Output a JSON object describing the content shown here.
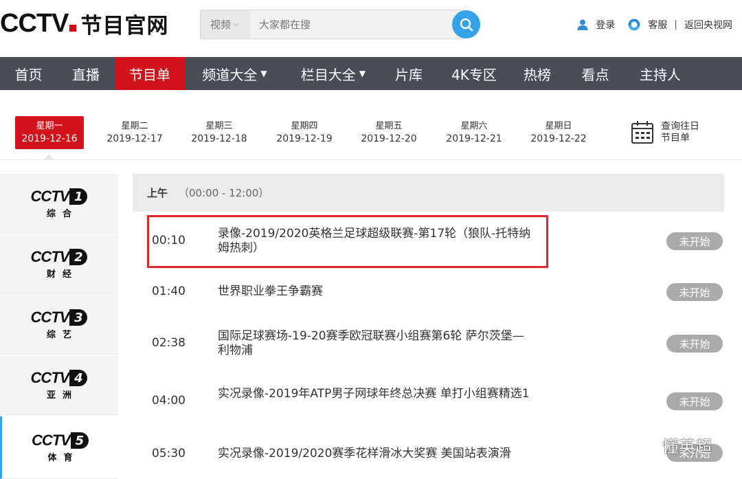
{
  "header": {
    "logo_text": "CCTV",
    "site_name": "节目官网",
    "search": {
      "category": "视频",
      "placeholder": "大家都在搜"
    },
    "login": "登录",
    "service": "客服",
    "separator": "|",
    "return_link": "返回央视网"
  },
  "nav": {
    "items": [
      {
        "label": "首页"
      },
      {
        "label": "直播"
      },
      {
        "label": "节目单"
      },
      {
        "label": "频道大全"
      },
      {
        "label": "栏目大全"
      },
      {
        "label": "片库"
      },
      {
        "label": "4K专区"
      },
      {
        "label": "热榜"
      },
      {
        "label": "看点"
      },
      {
        "label": "主持人"
      }
    ]
  },
  "dates": [
    {
      "weekday": "星期一",
      "date": "2019-12-16"
    },
    {
      "weekday": "星期二",
      "date": "2019-12-17"
    },
    {
      "weekday": "星期三",
      "date": "2019-12-18"
    },
    {
      "weekday": "星期四",
      "date": "2019-12-19"
    },
    {
      "weekday": "星期五",
      "date": "2019-12-20"
    },
    {
      "weekday": "星期六",
      "date": "2019-12-21"
    },
    {
      "weekday": "星期日",
      "date": "2019-12-22"
    }
  ],
  "history": {
    "line1": "查询往日",
    "line2": "节目单"
  },
  "channels": [
    {
      "brand": "CCTV",
      "num": "1",
      "name": "综合"
    },
    {
      "brand": "CCTV",
      "num": "2",
      "name": "财经"
    },
    {
      "brand": "CCTV",
      "num": "3",
      "name": "综艺"
    },
    {
      "brand": "CCTV",
      "num": "4",
      "name": "亚洲"
    },
    {
      "brand": "CCTV",
      "num": "5",
      "name": "体育"
    }
  ],
  "schedule": {
    "period": "上午",
    "range": "（00:00 - 12:00）",
    "rows": [
      {
        "time": "00:10",
        "title": "录像-2019/2020英格兰足球超级联赛-第17轮（狼队-托特纳姆热刺）",
        "status": "未开始"
      },
      {
        "time": "01:40",
        "title": "世界职业拳王争霸赛",
        "status": "未开始"
      },
      {
        "time": "02:38",
        "title": "国际足球赛场-19-20赛季欧冠联赛小组赛第6轮 萨尔茨堡—利物浦",
        "status": "未开始"
      },
      {
        "time": "04:00",
        "title": "实况录像-2019年ATP男子网球年终总决赛 单打小组赛精选1",
        "status": "未开始"
      },
      {
        "time": "05:30",
        "title": "实况录像-2019/2020赛季花样滑冰大奖赛 美国站表演滑",
        "status": "未开始"
      }
    ]
  },
  "watermark": "懂英超",
  "colors": {
    "accent_red": "#d3121b",
    "nav_bg": "#4a4d55",
    "search_blue": "#35a3e8",
    "status_gray": "#aaaaaa"
  }
}
